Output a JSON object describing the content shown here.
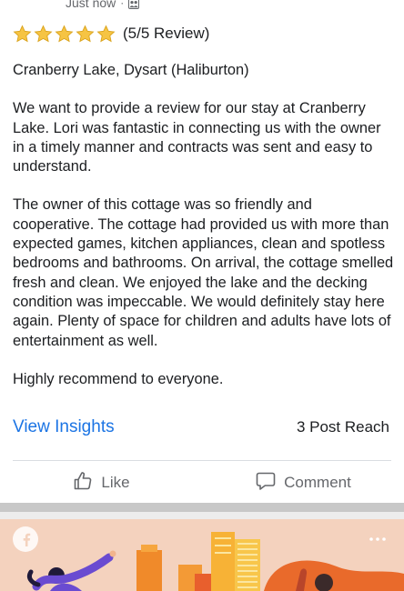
{
  "post": {
    "timestamp": "Just now",
    "separator": "·",
    "rating_text": "(5/5 Review)",
    "stars": 5,
    "location_line": "Cranberry Lake, Dysart (Haliburton)",
    "paragraph_1": "We want to provide a review for our stay at Cranberry Lake. Lori was fantastic in connecting us with the owner in a timely manner and contracts was sent and easy to understand.",
    "paragraph_2": "The owner of this cottage was so friendly and cooperative. The cottage had provided us with more than expected games, kitchen appliances, clean and spotless bedrooms and bathrooms. On arrival, the cottage smelled fresh and clean. We enjoyed the lake and the decking condition was impeccable. We would definitely stay here again. Plenty of space for children and adults have lots of entertainment as well.",
    "paragraph_3": "Highly recommend to everyone."
  },
  "insights": {
    "link_label": "View Insights",
    "reach_label": "3 Post Reach"
  },
  "actions": {
    "like_label": "Like",
    "comment_label": "Comment"
  },
  "colors": {
    "link_blue": "#1b74e4",
    "muted_gray": "#65676b",
    "star_gold": "#f6c443",
    "banner_bg": "#f3d2bf"
  },
  "icons": {
    "audience": "audience-icon",
    "star": "star-icon",
    "like": "thumbs-up-icon",
    "comment": "comment-bubble-icon",
    "facebook": "facebook-logo-icon",
    "more": "more-dots-icon"
  }
}
